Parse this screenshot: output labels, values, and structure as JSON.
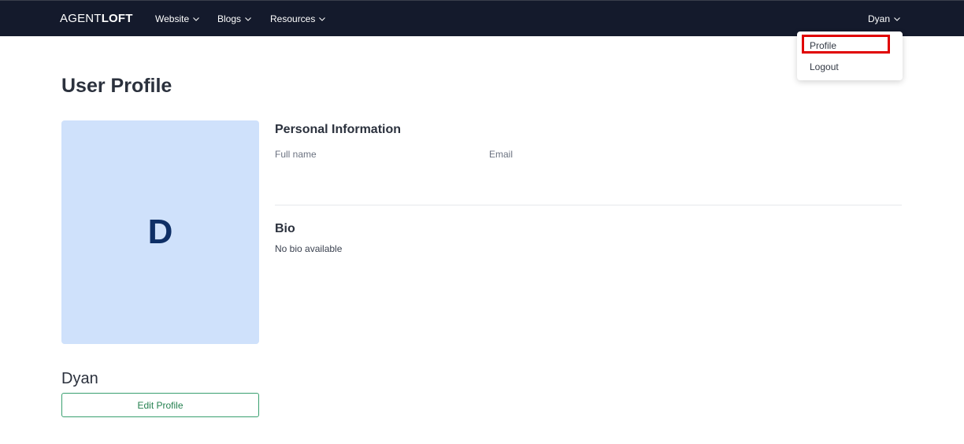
{
  "navbar": {
    "brand_light": "AGENT",
    "brand_bold": "LOFT",
    "items": [
      {
        "label": "Website",
        "icon": "chevron-down-icon"
      },
      {
        "label": "Blogs",
        "icon": "chevron-down-icon"
      },
      {
        "label": "Resources",
        "icon": "chevron-down-icon"
      }
    ],
    "user_label": "Dyan",
    "background_color": "#141a2c"
  },
  "user_dropdown": {
    "items": [
      {
        "label": "Profile"
      },
      {
        "label": "Logout"
      }
    ],
    "highlight_color": "#e00000"
  },
  "page": {
    "title": "User Profile"
  },
  "profile_card": {
    "avatar_initial": "D",
    "avatar_bg_color": "#cfe1fb",
    "name": "Dyan",
    "edit_button_label": "Edit Profile",
    "edit_button_color": "#3aa070"
  },
  "personal_info": {
    "title": "Personal Information",
    "full_name_label": "Full name",
    "email_label": "Email"
  },
  "bio": {
    "title": "Bio",
    "text": "No bio available"
  }
}
